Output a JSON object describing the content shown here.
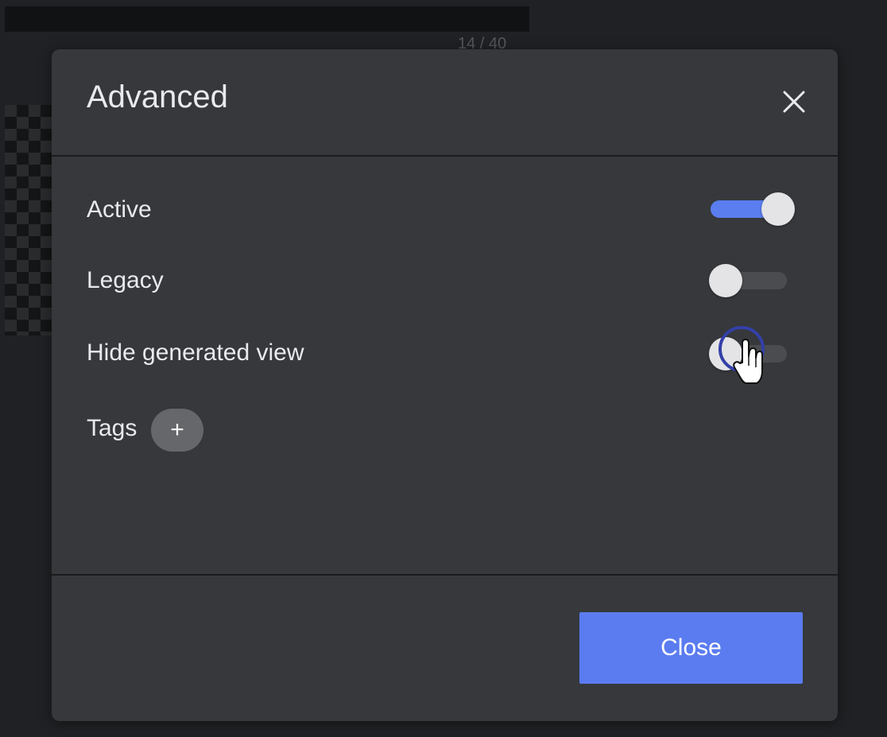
{
  "background": {
    "page_counter": "14 / 40"
  },
  "modal": {
    "title": "Advanced",
    "close_icon": "close-icon",
    "rows": [
      {
        "label": "Active",
        "toggle_on": true
      },
      {
        "label": "Legacy",
        "toggle_on": false
      },
      {
        "label": "Hide generated view",
        "toggle_on": false
      }
    ],
    "tags": {
      "label": "Tags",
      "add_symbol": "+",
      "add_icon": "plus-icon"
    },
    "footer": {
      "close_label": "Close"
    }
  },
  "colors": {
    "accent": "#5b7cf0",
    "modal_background": "#36383c",
    "page_background": "#202124",
    "focus_ring": "#3340a8"
  }
}
